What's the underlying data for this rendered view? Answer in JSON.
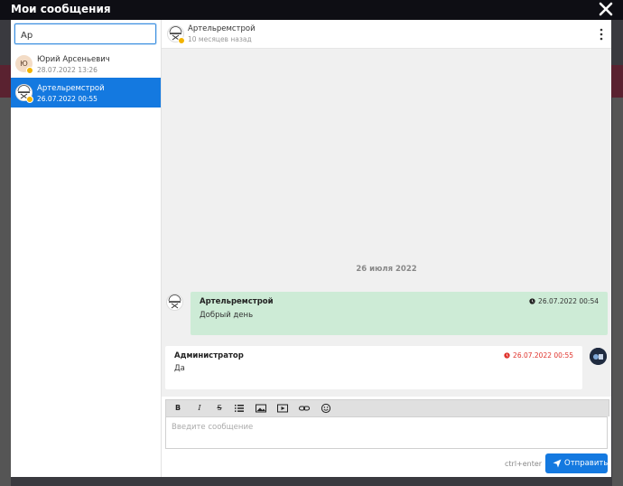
{
  "modal": {
    "title": "Мои сообщения"
  },
  "search": {
    "value": "Ар"
  },
  "contacts": [
    {
      "initials": "Ю",
      "name": "Юрий Арсеньевич",
      "date": "28.07.2022 13:26"
    },
    {
      "name": "Артельремстрой",
      "date": "26.07.2022 00:55",
      "selected": true
    }
  ],
  "chat": {
    "header": {
      "name": "Артельремстрой",
      "status": "10 месяцев назад"
    },
    "date_separator": "26 июля 2022",
    "messages": [
      {
        "author": "Артельремстрой",
        "text": "Добрый день",
        "time": "26.07.2022 00:54"
      },
      {
        "author": "Администратор",
        "text": "Да",
        "time": "26.07.2022 00:55"
      }
    ]
  },
  "composer": {
    "toolbar": {
      "bold": "B",
      "italic": "I",
      "strike": "S"
    },
    "placeholder": "Введите сообщение",
    "hint": "ctrl+enter",
    "send_label": "Отправить"
  },
  "colors": {
    "accent": "#1479e0",
    "incoming_bg": "#cdebd6",
    "status_dot": "#f2b300",
    "alert_time": "#e0342d"
  }
}
